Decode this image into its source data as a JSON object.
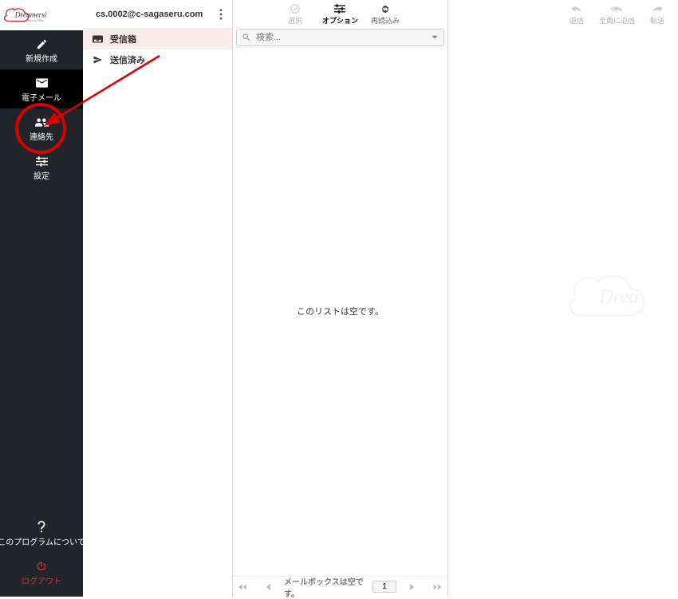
{
  "brand": {
    "name": "Dreamersi",
    "subtitle": "Powered by PSPinc"
  },
  "sidebar": {
    "items": [
      {
        "label": "新規作成"
      },
      {
        "label": "電子メール"
      },
      {
        "label": "連絡先"
      },
      {
        "label": "設定"
      }
    ],
    "bottom": [
      {
        "label": "?"
      },
      {
        "label": "このプログラムについて"
      },
      {
        "label": "ログアウト"
      }
    ]
  },
  "account": {
    "email": "cs.0002@c-sagaseru.com"
  },
  "folders": [
    {
      "name": "受信箱"
    },
    {
      "name": "送信済み"
    }
  ],
  "toolbar_mid": {
    "select": "選択",
    "options": "オプション",
    "reload": "再読込み"
  },
  "toolbar_right": {
    "reply": "返信",
    "reply_all": "全員に返信",
    "forward": "転送"
  },
  "search": {
    "placeholder": "検索..."
  },
  "list": {
    "empty": "このリストは空です。"
  },
  "pager": {
    "status": "メールボックスは空です。",
    "page": "1"
  }
}
